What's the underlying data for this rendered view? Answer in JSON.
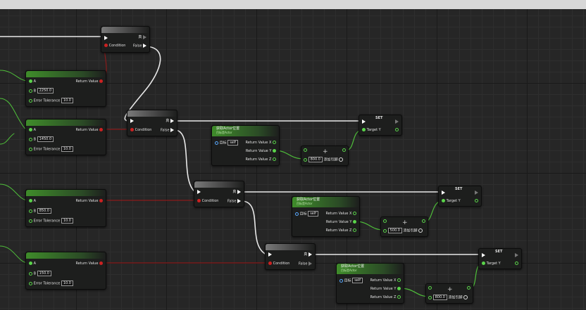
{
  "labels": {
    "true_label": "真",
    "false_label": "False",
    "condition_label": "Condition",
    "pin_a": "A",
    "pin_b": "B",
    "error_tolerance": "Error Tolerance",
    "return_value": "Return Value",
    "target_label": "目标",
    "self_value": "self",
    "return_x": "Return Value X",
    "return_y": "Return Value Y",
    "return_z": "Return Value Z",
    "set_label": "SET",
    "target_y": "Target Y",
    "add_pin": "添加引脚"
  },
  "nearly_equal": [
    {
      "b": "2250.0",
      "tolerance": "10.0"
    },
    {
      "b": "1450.0",
      "tolerance": "10.0"
    },
    {
      "b": "850.0",
      "tolerance": "10.0"
    },
    {
      "b": "150.0",
      "tolerance": "10.0"
    }
  ],
  "actor_location": {
    "title": "获取Actor位置",
    "subtitle": "目标是Actor"
  },
  "adds": [
    {
      "value": "800.0"
    },
    {
      "value": "500.0"
    },
    {
      "value": "800.0"
    }
  ],
  "colors": {
    "exec_wire": "#ffffff",
    "bool_wire": "#8a1b1b",
    "float_wire": "#4fbf3a",
    "node_header": "#3f8c2a"
  }
}
